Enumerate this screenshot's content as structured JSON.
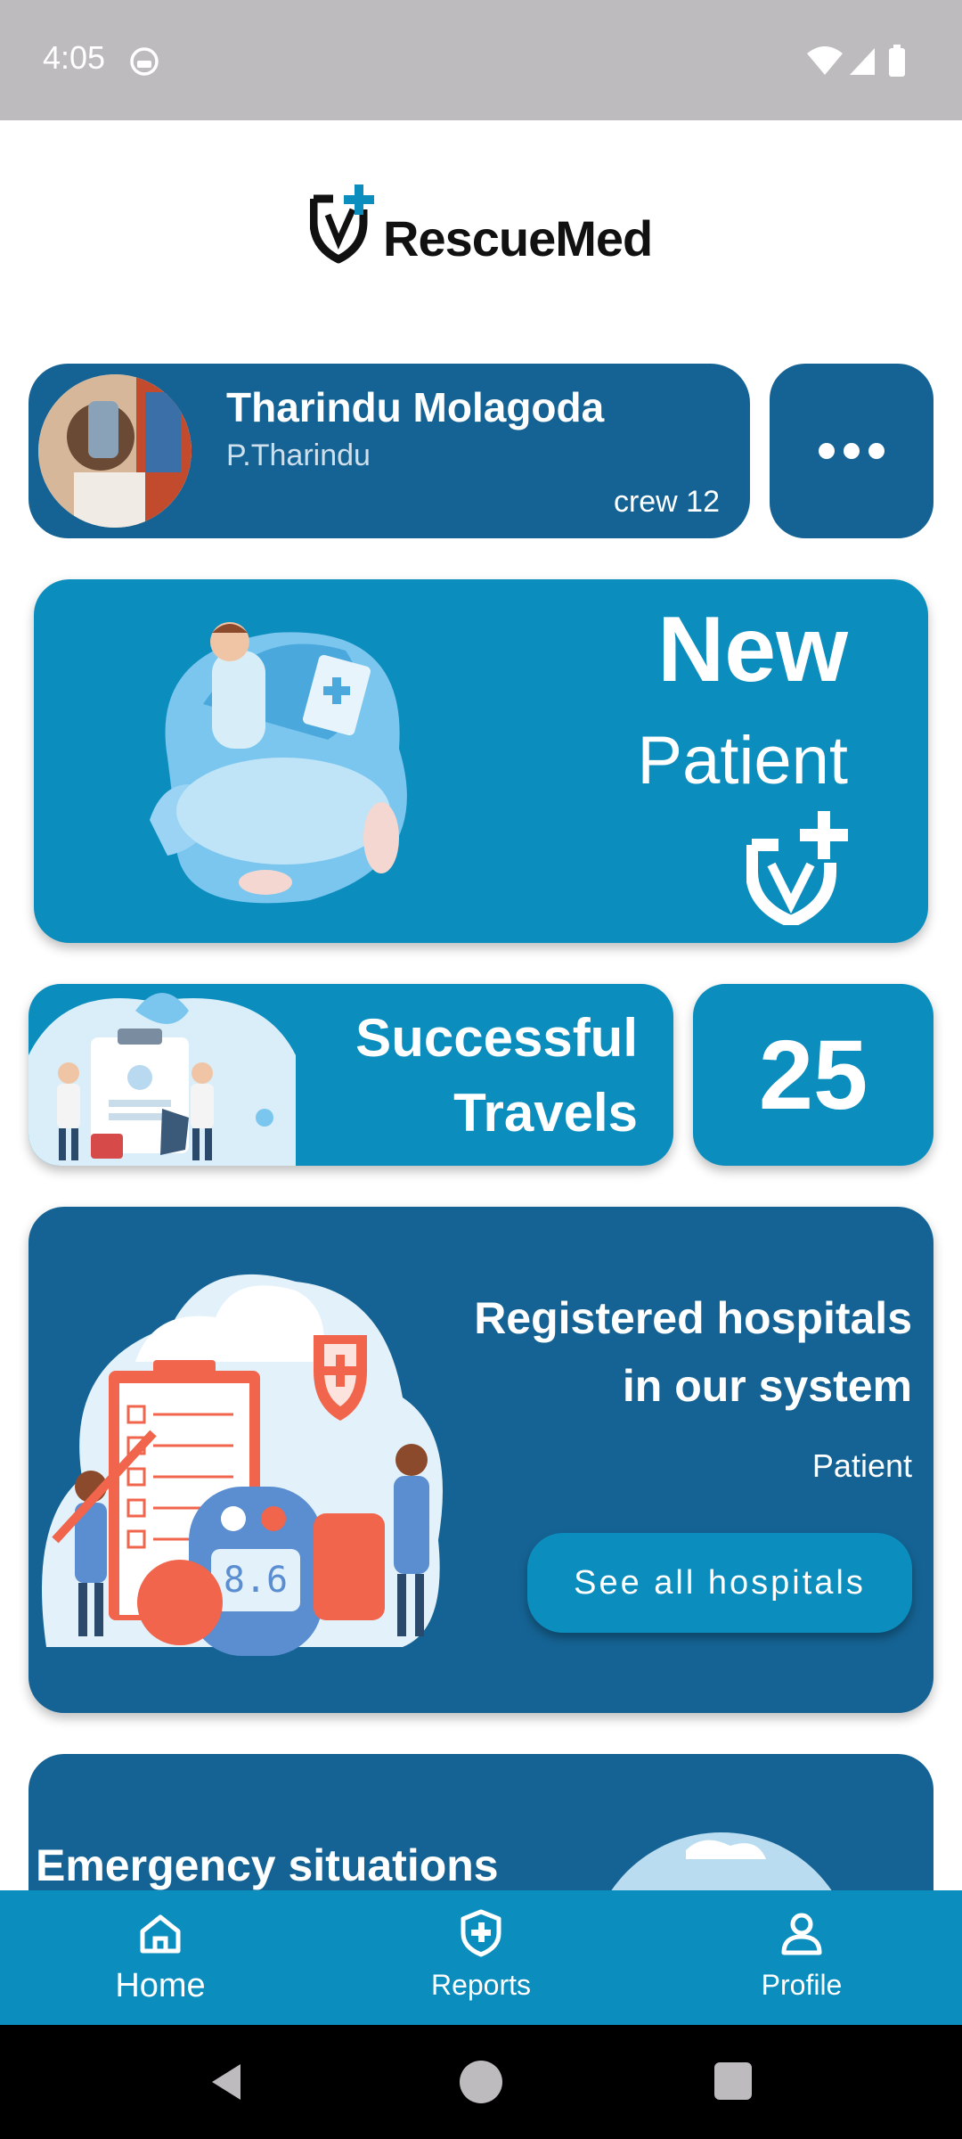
{
  "status_bar": {
    "time": "4:05"
  },
  "app": {
    "logo_text": "RescueMed",
    "brand_color": "#156394",
    "accent_color": "#0b8dbe"
  },
  "profile": {
    "name": "Tharindu Molagoda",
    "username": "P.Tharindu",
    "crew": "crew 12"
  },
  "new_patient": {
    "title": "New",
    "subtitle": "Patient"
  },
  "travels": {
    "label_line1": "Successful",
    "label_line2": "Travels",
    "count": "25"
  },
  "hospitals": {
    "title_line1": "Registered hospitals",
    "title_line2": "in our system",
    "subtitle": "Patient",
    "button_label": "See all hospitals"
  },
  "emergency": {
    "title": "Emergency situations"
  },
  "bottom_nav": [
    {
      "label": "Home",
      "icon": "home-icon"
    },
    {
      "label": "Reports",
      "icon": "shield-plus-icon"
    },
    {
      "label": "Profile",
      "icon": "user-badge-icon"
    }
  ]
}
